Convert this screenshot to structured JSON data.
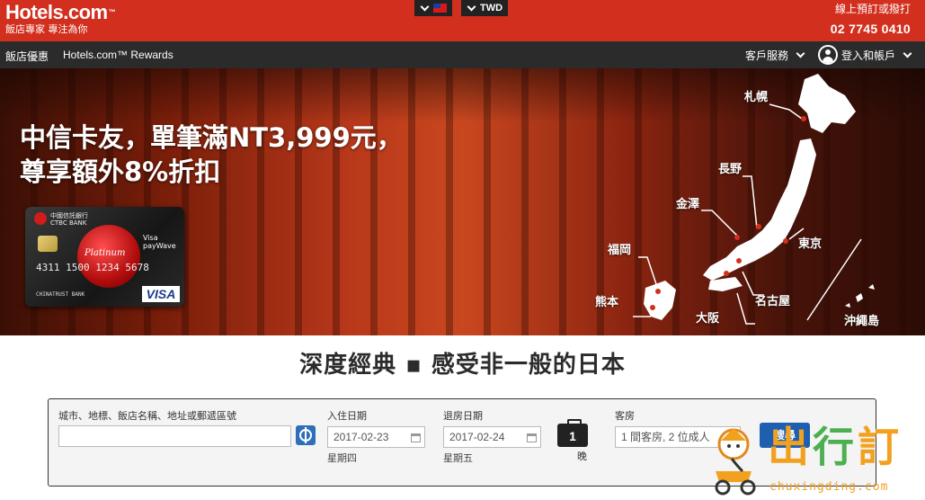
{
  "header": {
    "logo_text": "Hotels.com",
    "logo_tm": "™",
    "logo_sub": "飯店專家 專注為你",
    "locale_currency": "TWD",
    "phone_label": "線上預訂或撥打",
    "phone_number": "02 7745 0410",
    "brand_color": "#d32f1e"
  },
  "nav": {
    "left": [
      "飯店優惠",
      "Hotels.com™ Rewards"
    ],
    "customer_service": "客戶服務",
    "login": "登入和帳戶"
  },
  "hero": {
    "title_line1": "中信卡友，單筆滿NT3,999元，",
    "title_line2": "尊享額外8%折扣",
    "card": {
      "bank_name": "中國信託銀行",
      "bank_name_en": "CTBC BANK",
      "platinum": "Platinum",
      "visa_wave": "Visa payWave",
      "number": "4311 1500 1234 5678",
      "holder": "CHINATRUST BANK",
      "visa": "VISA"
    },
    "map_labels": {
      "sapporo": "札幌",
      "nagano": "長野",
      "kanazawa": "金澤",
      "tokyo": "東京",
      "fukuoka": "福岡",
      "kumamoto": "熊本",
      "nagoya": "名古屋",
      "osaka": "大阪",
      "okinawa": "沖繩島"
    }
  },
  "tagline": "深度經典 ▪ 感受非一般的日本",
  "search": {
    "destination_label": "城市、地標、飯店名稱、地址或郵遞區號",
    "destination_value": "",
    "checkin_label": "入住日期",
    "checkin_value": "2017-02-23",
    "checkin_weekday": "星期四",
    "checkout_label": "退房日期",
    "checkout_value": "2017-02-24",
    "checkout_weekday": "星期五",
    "nights": "1",
    "nights_unit": "晚",
    "rooms_label": "客房",
    "rooms_value": "1 間客房, 2 位成人",
    "search_button": "搜尋"
  },
  "watermark": {
    "text_1": "出",
    "text_2": "行",
    "text_3": "訂",
    "url": "chuxingding.com"
  }
}
